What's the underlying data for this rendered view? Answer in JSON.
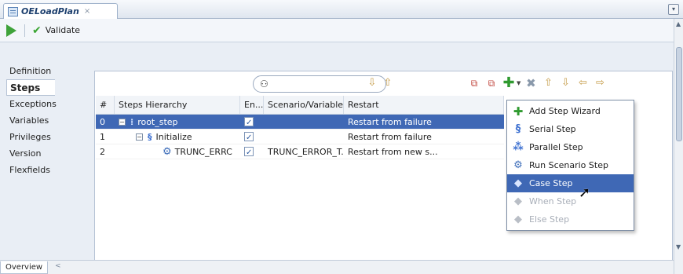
{
  "tab": {
    "title": "OELoadPlan",
    "close": "×",
    "menu": "▾"
  },
  "toolbar": {
    "run": "",
    "validate": "Validate"
  },
  "sections": [
    "Definition",
    "Steps",
    "Exceptions",
    "Variables",
    "Privileges",
    "Version",
    "Flexfields"
  ],
  "active_section": "Steps",
  "table": {
    "headers": [
      "#",
      "Steps Hierarchy",
      "En...",
      "Scenario/Variable",
      "Restart"
    ],
    "rows": [
      {
        "num": "0",
        "name": "root_step",
        "enabled": true,
        "scenario": "",
        "restart": "Restart from failure"
      },
      {
        "num": "1",
        "name": "Initialize",
        "enabled": true,
        "scenario": "",
        "restart": "Restart from failure"
      },
      {
        "num": "2",
        "name": "TRUNC_ERRC",
        "enabled": true,
        "scenario": "TRUNC_ERROR_T...",
        "restart": "Restart from new s..."
      }
    ]
  },
  "menu": {
    "items": [
      {
        "label": "Add Step Wizard",
        "icon": "add-icon",
        "state": "normal"
      },
      {
        "label": "Serial Step",
        "icon": "serial-step-icon",
        "state": "normal"
      },
      {
        "label": "Parallel Step",
        "icon": "parallel-step-icon",
        "state": "normal"
      },
      {
        "label": "Run Scenario Step",
        "icon": "scenario-icon",
        "state": "normal"
      },
      {
        "label": "Case Step",
        "icon": "case-step-icon",
        "state": "hover"
      },
      {
        "label": "When Step",
        "icon": "diamond-icon",
        "state": "disabled"
      },
      {
        "label": "Else Step",
        "icon": "diamond-icon",
        "state": "disabled"
      }
    ]
  },
  "footer": {
    "overview": "Overview",
    "scroll_left": "<"
  },
  "colors": {
    "selection": "#3f68b5",
    "add_green": "#2f9a2f"
  }
}
